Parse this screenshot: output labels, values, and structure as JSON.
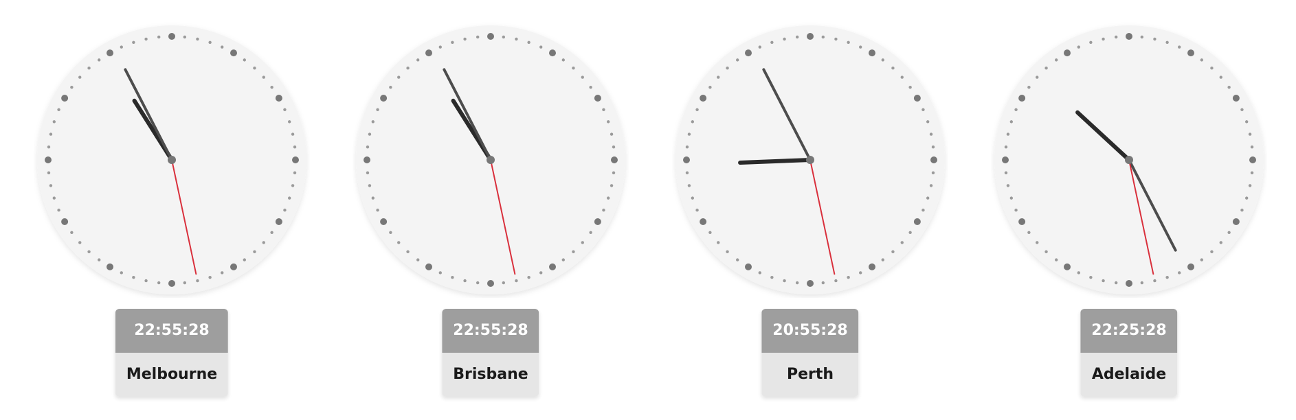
{
  "clocks": [
    {
      "city": "Melbourne",
      "time": "22:55:28",
      "hours": 22,
      "minutes": 55,
      "seconds": 28
    },
    {
      "city": "Brisbane",
      "time": "22:55:28",
      "hours": 22,
      "minutes": 55,
      "seconds": 28
    },
    {
      "city": "Perth",
      "time": "20:55:28",
      "hours": 20,
      "minutes": 55,
      "seconds": 28
    },
    {
      "city": "Adelaide",
      "time": "22:25:28",
      "hours": 22,
      "minutes": 25,
      "seconds": 28
    }
  ],
  "colors": {
    "face": "#f4f4f4",
    "tick_major": "#777777",
    "tick_minor": "#9a9a9a",
    "hour_hand": "#2a2a2a",
    "minute_hand": "#4d4d4d",
    "second_hand": "#d9303c",
    "center_dot": "#777777"
  }
}
